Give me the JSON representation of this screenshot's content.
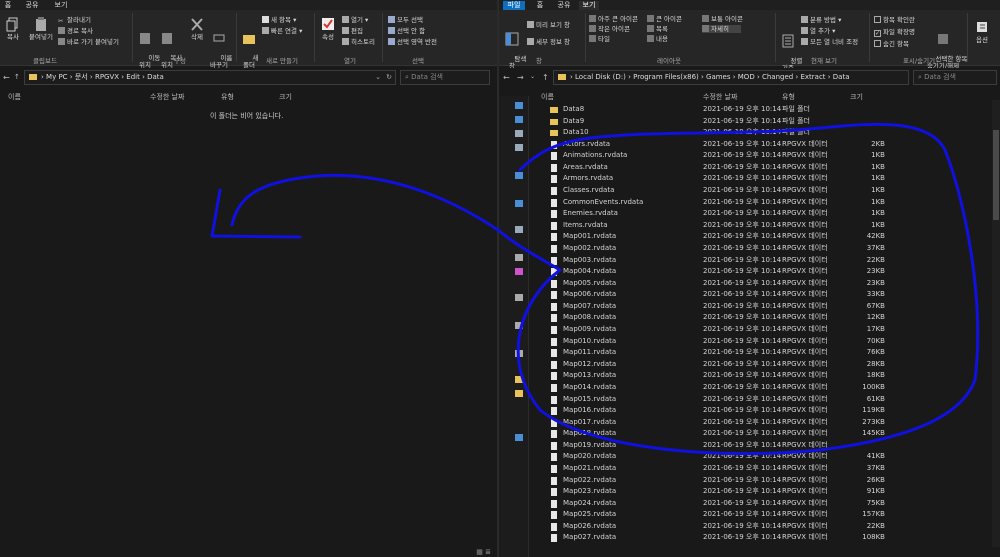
{
  "left": {
    "tabs": [
      "홈",
      "공유",
      "보기"
    ],
    "ribbon": {
      "paste": "붙여넣기",
      "copy": "복사",
      "cut": "잘라내기",
      "copy_path": "경로 복사",
      "paste_shortcut": "바로 가기 붙여넣기",
      "move_to": "이동\n위치",
      "copy_to": "복사\n위치",
      "delete": "삭제",
      "rename": "이름\n바꾸기",
      "new_folder": "새\n폴더",
      "new_item": "새 항목",
      "easy_access": "빠른 연결",
      "properties": "속성",
      "open": "열기",
      "edit": "편집",
      "history": "히스토리",
      "select_all": "모두 선택",
      "select_none": "선택 안 함",
      "invert_selection": "선택 영역 반전",
      "groups": [
        "클립보드",
        "구성",
        "새로 만들기",
        "열기",
        "선택"
      ]
    },
    "path": [
      "My PC",
      "문서",
      "RPGVX",
      "Edit",
      "Data"
    ],
    "search_placeholder": "Data 검색",
    "columns": [
      "이름",
      "수정한 날짜",
      "유형",
      "크기"
    ],
    "empty_message": "이 폴더는 비어 있습니다."
  },
  "right": {
    "tabs": [
      "파일",
      "홈",
      "공유",
      "보기"
    ],
    "ribbon": {
      "nav_pane": "탐색\n창",
      "preview_pane": "미리 보기 창",
      "details_pane": "세부 정보 창",
      "layout_items": [
        "아주 큰 아이콘",
        "큰 아이콘",
        "보통 아이콘",
        "작은 아이콘",
        "목록",
        "자세히",
        "타일",
        "내용"
      ],
      "sort_by": "정렬\n기준",
      "group_by": "분류 방법",
      "add_columns": "열 추가",
      "size_all_columns": "모든 열 너비 조정",
      "item_checkboxes": "항목 확인란",
      "file_extensions": "파일 확장명",
      "hidden_items": "숨긴 항목",
      "hide_selected": "선택한 항목\n숨기기/해제",
      "options": "옵션",
      "groups": [
        "창",
        "레이아웃",
        "현재 보기",
        "표시/숨기기"
      ]
    },
    "path": [
      "Local Disk (D:)",
      "Program Files(x86)",
      "Games",
      "MOD",
      "Changed",
      "Extract",
      "Data"
    ],
    "search_placeholder": "Data 검색",
    "columns": [
      "이름",
      "수정한 날짜",
      "유형",
      "크기"
    ],
    "files": [
      {
        "name": "Data8",
        "date": "2021-06-19 오후 10:14",
        "type": "파일 폴더",
        "size": "",
        "kind": "folder"
      },
      {
        "name": "Data9",
        "date": "2021-06-19 오후 10:14",
        "type": "파일 폴더",
        "size": "",
        "kind": "folder"
      },
      {
        "name": "Data10",
        "date": "2021-06-19 오후 10:14",
        "type": "파일 폴더",
        "size": "",
        "kind": "folder"
      },
      {
        "name": "Actors.rvdata",
        "date": "2021-06-19 오후 10:14",
        "type": "RPGVX 데이터",
        "size": "2KB",
        "kind": "file"
      },
      {
        "name": "Animations.rvdata",
        "date": "2021-06-19 오후 10:14",
        "type": "RPGVX 데이터",
        "size": "1KB",
        "kind": "file"
      },
      {
        "name": "Areas.rvdata",
        "date": "2021-06-19 오후 10:14",
        "type": "RPGVX 데이터",
        "size": "1KB",
        "kind": "file"
      },
      {
        "name": "Armors.rvdata",
        "date": "2021-06-19 오후 10:14",
        "type": "RPGVX 데이터",
        "size": "1KB",
        "kind": "file"
      },
      {
        "name": "Classes.rvdata",
        "date": "2021-06-19 오후 10:14",
        "type": "RPGVX 데이터",
        "size": "1KB",
        "kind": "file"
      },
      {
        "name": "CommonEvents.rvdata",
        "date": "2021-06-19 오후 10:14",
        "type": "RPGVX 데이터",
        "size": "1KB",
        "kind": "file"
      },
      {
        "name": "Enemies.rvdata",
        "date": "2021-06-19 오후 10:14",
        "type": "RPGVX 데이터",
        "size": "1KB",
        "kind": "file"
      },
      {
        "name": "Items.rvdata",
        "date": "2021-06-19 오후 10:14",
        "type": "RPGVX 데이터",
        "size": "1KB",
        "kind": "file"
      },
      {
        "name": "Map001.rvdata",
        "date": "2021-06-19 오후 10:14",
        "type": "RPGVX 데이터",
        "size": "42KB",
        "kind": "file"
      },
      {
        "name": "Map002.rvdata",
        "date": "2021-06-19 오후 10:14",
        "type": "RPGVX 데이터",
        "size": "37KB",
        "kind": "file"
      },
      {
        "name": "Map003.rvdata",
        "date": "2021-06-19 오후 10:14",
        "type": "RPGVX 데이터",
        "size": "22KB",
        "kind": "file"
      },
      {
        "name": "Map004.rvdata",
        "date": "2021-06-19 오후 10:14",
        "type": "RPGVX 데이터",
        "size": "23KB",
        "kind": "file"
      },
      {
        "name": "Map005.rvdata",
        "date": "2021-06-19 오후 10:14",
        "type": "RPGVX 데이터",
        "size": "23KB",
        "kind": "file"
      },
      {
        "name": "Map006.rvdata",
        "date": "2021-06-19 오후 10:14",
        "type": "RPGVX 데이터",
        "size": "33KB",
        "kind": "file"
      },
      {
        "name": "Map007.rvdata",
        "date": "2021-06-19 오후 10:14",
        "type": "RPGVX 데이터",
        "size": "67KB",
        "kind": "file"
      },
      {
        "name": "Map008.rvdata",
        "date": "2021-06-19 오후 10:14",
        "type": "RPGVX 데이터",
        "size": "12KB",
        "kind": "file"
      },
      {
        "name": "Map009.rvdata",
        "date": "2021-06-19 오후 10:14",
        "type": "RPGVX 데이터",
        "size": "17KB",
        "kind": "file"
      },
      {
        "name": "Map010.rvdata",
        "date": "2021-06-19 오후 10:14",
        "type": "RPGVX 데이터",
        "size": "70KB",
        "kind": "file"
      },
      {
        "name": "Map011.rvdata",
        "date": "2021-06-19 오후 10:14",
        "type": "RPGVX 데이터",
        "size": "76KB",
        "kind": "file"
      },
      {
        "name": "Map012.rvdata",
        "date": "2021-06-19 오후 10:14",
        "type": "RPGVX 데이터",
        "size": "28KB",
        "kind": "file"
      },
      {
        "name": "Map013.rvdata",
        "date": "2021-06-19 오후 10:14",
        "type": "RPGVX 데이터",
        "size": "18KB",
        "kind": "file"
      },
      {
        "name": "Map014.rvdata",
        "date": "2021-06-19 오후 10:14",
        "type": "RPGVX 데이터",
        "size": "100KB",
        "kind": "file"
      },
      {
        "name": "Map015.rvdata",
        "date": "2021-06-19 오후 10:14",
        "type": "RPGVX 데이터",
        "size": "61KB",
        "kind": "file"
      },
      {
        "name": "Map016.rvdata",
        "date": "2021-06-19 오후 10:14",
        "type": "RPGVX 데이터",
        "size": "119KB",
        "kind": "file"
      },
      {
        "name": "Map017.rvdata",
        "date": "2021-06-19 오후 10:14",
        "type": "RPGVX 데이터",
        "size": "273KB",
        "kind": "file"
      },
      {
        "name": "Map018.rvdata",
        "date": "2021-06-19 오후 10:14",
        "type": "RPGVX 데이터",
        "size": "145KB",
        "kind": "file"
      },
      {
        "name": "Map019.rvdata",
        "date": "2021-06-19 오후 10:14",
        "type": "RPGVX 데이터",
        "size": "",
        "kind": "file"
      },
      {
        "name": "Map020.rvdata",
        "date": "2021-06-19 오후 10:14",
        "type": "RPGVX 데이터",
        "size": "41KB",
        "kind": "file"
      },
      {
        "name": "Map021.rvdata",
        "date": "2021-06-19 오후 10:14",
        "type": "RPGVX 데이터",
        "size": "37KB",
        "kind": "file"
      },
      {
        "name": "Map022.rvdata",
        "date": "2021-06-19 오후 10:14",
        "type": "RPGVX 데이터",
        "size": "26KB",
        "kind": "file"
      },
      {
        "name": "Map023.rvdata",
        "date": "2021-06-19 오후 10:14",
        "type": "RPGVX 데이터",
        "size": "91KB",
        "kind": "file"
      },
      {
        "name": "Map024.rvdata",
        "date": "2021-06-19 오후 10:14",
        "type": "RPGVX 데이터",
        "size": "75KB",
        "kind": "file"
      },
      {
        "name": "Map025.rvdata",
        "date": "2021-06-19 오후 10:14",
        "type": "RPGVX 데이터",
        "size": "157KB",
        "kind": "file"
      },
      {
        "name": "Map026.rvdata",
        "date": "2021-06-19 오후 10:14",
        "type": "RPGVX 데이터",
        "size": "22KB",
        "kind": "file"
      },
      {
        "name": "Map027.rvdata",
        "date": "2021-06-19 오후 10:14",
        "type": "RPGVX 데이터",
        "size": "108KB",
        "kind": "file"
      }
    ]
  },
  "colors": {
    "background": "#191919",
    "ribbon": "#262626",
    "active_tab": "#0e6fbf",
    "folder": "#e8c25a",
    "annotation": "#1010e0"
  }
}
